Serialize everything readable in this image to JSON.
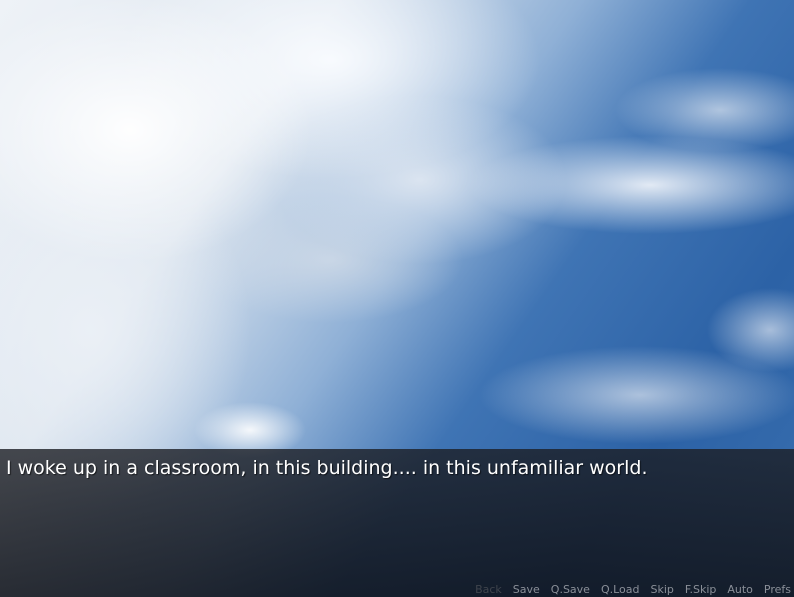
{
  "dialogue": {
    "text": "I woke up in a classroom, in this building.... in this unfamiliar world."
  },
  "quick_menu": {
    "back": "Back",
    "save": "Save",
    "qsave": "Q.Save",
    "qload": "Q.Load",
    "skip": "Skip",
    "fskip": "F.Skip",
    "auto": "Auto",
    "prefs": "Prefs"
  },
  "colors": {
    "dialogue_text": "#ffffff",
    "menu_text": "#8a8f98",
    "menu_disabled": "#3f444c",
    "textbox_bg": "#1a1c22"
  }
}
